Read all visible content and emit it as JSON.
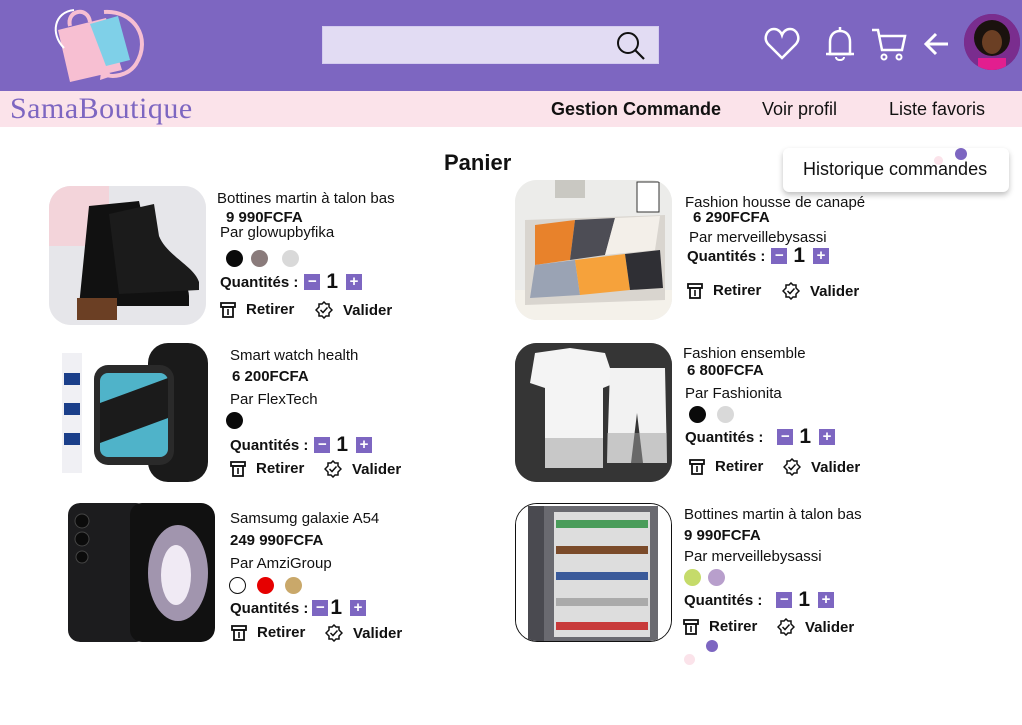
{
  "app": {
    "brand": "SamaBoutique",
    "accent": "#7d66c1",
    "nav_bg": "#fbe3ea"
  },
  "header": {
    "search": {
      "placeholder": "",
      "icon": "search-icon"
    },
    "icons": [
      "heart-icon",
      "bell-icon",
      "cart-icon",
      "back-arrow-icon"
    ]
  },
  "nav": {
    "gestion": "Gestion Commande",
    "profil": "Voir profil",
    "favoris": "Liste favoris",
    "historique": "Historique commandes"
  },
  "page": {
    "title": "Panier"
  },
  "labels": {
    "quantity": "Quantités :",
    "remove": "Retirer",
    "validate": "Valider"
  },
  "products": [
    {
      "name": "Bottines martin à talon bas",
      "price": "9 990FCFA",
      "seller": "Par glowupbyfika",
      "colors": [
        "#0a0a0a",
        "#8a7b7b",
        "#d9d9d9"
      ],
      "qty": "1"
    },
    {
      "name": "Fashion housse de canapé",
      "price": "6 290FCFA",
      "seller": "Par merveillebysassi",
      "colors": [],
      "qty": "1"
    },
    {
      "name": "Smart watch health",
      "price": "6 200FCFA",
      "seller": "Par FlexTech",
      "colors": [
        "#0a0a0a"
      ],
      "qty": "1"
    },
    {
      "name": "Fashion ensemble",
      "price": "6 800FCFA",
      "seller": "Par Fashionita",
      "colors": [
        "#0a0a0a",
        "#d9d9d9"
      ],
      "qty": "1"
    },
    {
      "name": "Samsumg galaxie A54",
      "price": "249 990FCFA",
      "seller": "Par AmziGroup",
      "colors": [
        "#ffffff",
        "#e60000",
        "#c9a86a"
      ],
      "qty": "1"
    },
    {
      "name": "Bottines martin à talon bas",
      "price": "9 990FCFA",
      "seller": "Par merveillebysassi",
      "colors": [
        "#c5db6a",
        "#b89fcc"
      ],
      "qty": "1"
    }
  ]
}
